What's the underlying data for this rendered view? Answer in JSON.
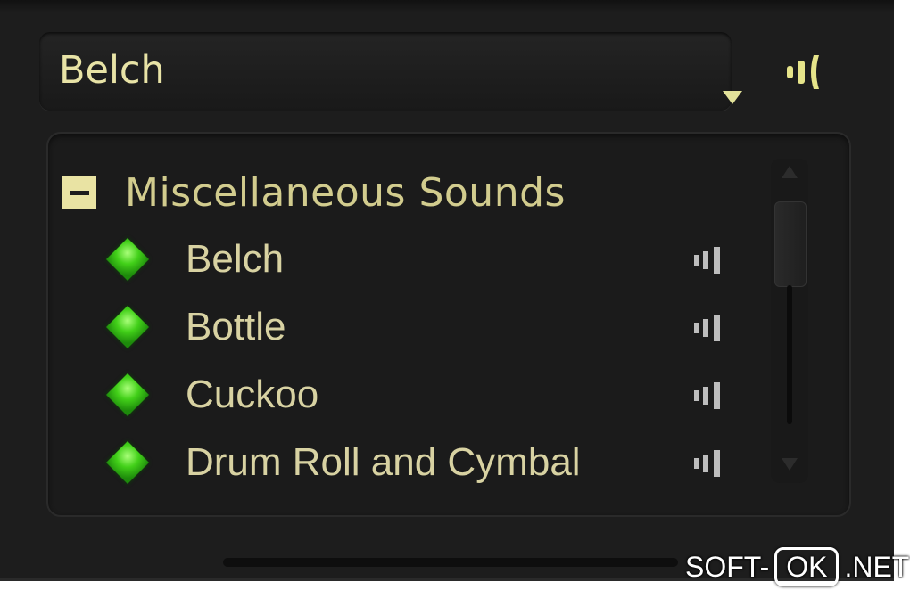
{
  "dropdown": {
    "selected": "Belch"
  },
  "list": {
    "group_label": "Miscellaneous Sounds",
    "items": [
      {
        "label": "Belch"
      },
      {
        "label": "Bottle"
      },
      {
        "label": "Cuckoo"
      },
      {
        "label": "Drum Roll and Cymbal"
      }
    ]
  },
  "icons": {
    "dropdown_arrow": "chevron-down-icon",
    "speaker": "speaker-icon",
    "item_play": "play-sound-icon",
    "item_bullet": "green-gem-icon",
    "group_toggle": "collapse-icon"
  },
  "colors": {
    "background": "#1d1d1d",
    "text": "#d8d2a2",
    "accent": "#e9e3a3",
    "gem": "#42d019"
  },
  "watermark": {
    "left": "SOFT-",
    "box": "OK",
    "right": ".NET"
  }
}
